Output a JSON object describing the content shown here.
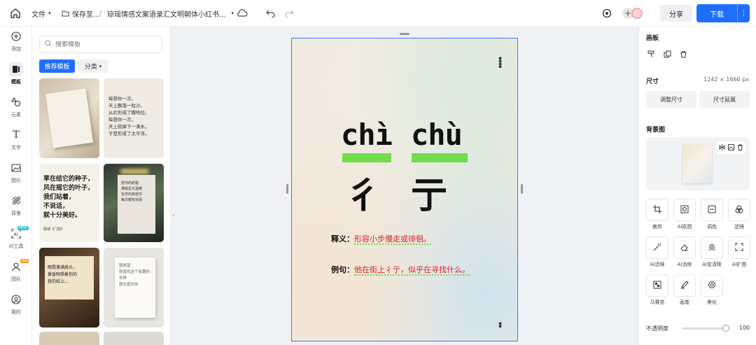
{
  "topbar": {
    "file_menu": "文件",
    "save_status": "保存至...",
    "separator": "/",
    "doc_title": "琼瑶情感文案语录汇文明朝体小红书...",
    "share_label": "分享",
    "download_label": "下载"
  },
  "rail": {
    "items": [
      {
        "label": "添加",
        "icon": "plus-circle-icon"
      },
      {
        "label": "模板",
        "icon": "template-icon"
      },
      {
        "label": "元素",
        "icon": "shapes-icon"
      },
      {
        "label": "文字",
        "icon": "text-icon"
      },
      {
        "label": "图片",
        "icon": "image-icon"
      },
      {
        "label": "背景",
        "icon": "background-icon"
      },
      {
        "label": "AI工具",
        "icon": "ai-tool-icon",
        "badge": "NEW"
      },
      {
        "label": "团队",
        "icon": "team-icon",
        "badge": "hot"
      },
      {
        "label": "我的",
        "icon": "profile-icon"
      }
    ]
  },
  "panel": {
    "search_placeholder": "搜索模板",
    "chip_recommended": "推荐模板",
    "chip_category": "分类",
    "thumbs": [
      {
        "text": ""
      },
      {
        "text": "每想你一次，\n天上飘落一粒沙，\n从此形成了撒哈拉。\n每想你一次，\n天上就掉下一滴水，\n于是形成了太平洋。"
      },
      {
        "text": "草在结它的种子，\n风在摇它的叶子，\n我们站着，\n不说话，\n就十分美好。",
        "caption": "顾城《门前》"
      },
      {
        "text": "愿你的航程\n满载星光温暖\n在你的旅途中\n每次都有惊喜"
      },
      {
        "text": "晚霞落满肩头，\n黄昏映照着你的\n我的纸上..."
      },
      {
        "text": "我希望\n你喜欢这个有趣的\n世界\n我也喜欢你"
      }
    ]
  },
  "artboard": {
    "pinyin_1": "chì",
    "pinyin_2": "chù",
    "hanzi_1": "彳",
    "hanzi_2": "亍",
    "meaning_key": "释义：",
    "meaning_val": "形容小步慢走或徘徊。",
    "example_key": "例句：",
    "example_val": "他在街上彳亍，似乎在寻找什么。"
  },
  "right": {
    "canvas_title": "画板",
    "size_title": "尺寸",
    "size_value": "1242 × 1660 px",
    "resize_label": "调整尺寸",
    "extend_label": "尺寸延展",
    "bg_title": "背景图",
    "tools": [
      "裁剪",
      "AI抠图",
      "调色",
      "滤镜",
      "AI滤镜",
      "AI消除",
      "AI变清晰",
      "AI扩图",
      "马赛克",
      "画笔",
      "美化"
    ],
    "opacity_label": "不透明度",
    "opacity_value": "100"
  },
  "colors": {
    "accent": "#1f6fff",
    "highlight_green": "#6fdc4c",
    "example_red": "#e01e2b"
  }
}
